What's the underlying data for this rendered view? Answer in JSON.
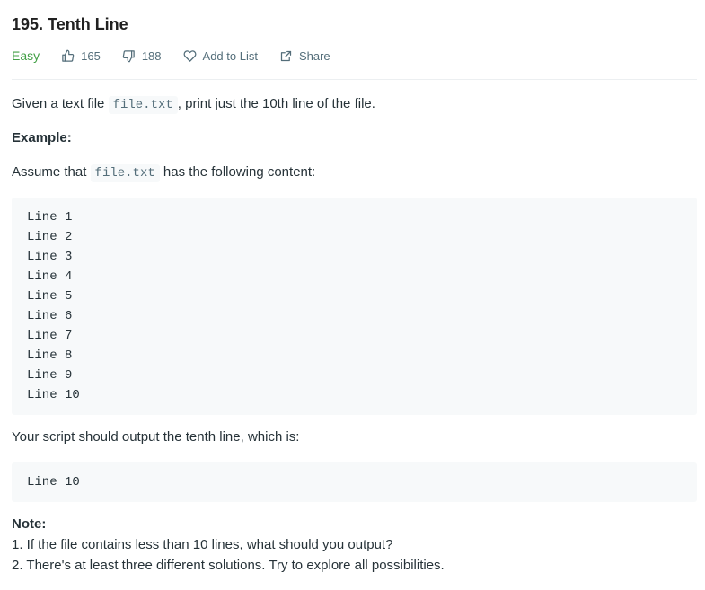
{
  "problem": {
    "title": "195. Tenth Line",
    "difficulty": "Easy",
    "likes": "165",
    "dislikes": "188",
    "add_to_list": "Add to List",
    "share": "Share"
  },
  "description": {
    "p1_before": "Given a text file ",
    "p1_code": "file.txt",
    "p1_after": ", print just the 10th line of the file.",
    "example_label": "Example:",
    "p2_before": "Assume that ",
    "p2_code": "file.txt",
    "p2_after": " has the following content:",
    "file_lines": [
      "Line 1",
      "Line 2",
      "Line 3",
      "Line 4",
      "Line 5",
      "Line 6",
      "Line 7",
      "Line 8",
      "Line 9",
      "Line 10"
    ],
    "p3": "Your script should output the tenth line, which is:",
    "output_line": "Line 10",
    "note_label": "Note:",
    "note1": "1. If the file contains less than 10 lines, what should you output?",
    "note2": "2. There's at least three different solutions. Try to explore all possibilities."
  },
  "colors": {
    "easy": "#43a047",
    "code_bg": "#f7f9fa",
    "text": "#263238",
    "muted": "#546e7a"
  },
  "icons": {
    "like": "thumbs-up-icon",
    "dislike": "thumbs-down-icon",
    "favorite": "heart-icon",
    "share": "share-icon"
  }
}
